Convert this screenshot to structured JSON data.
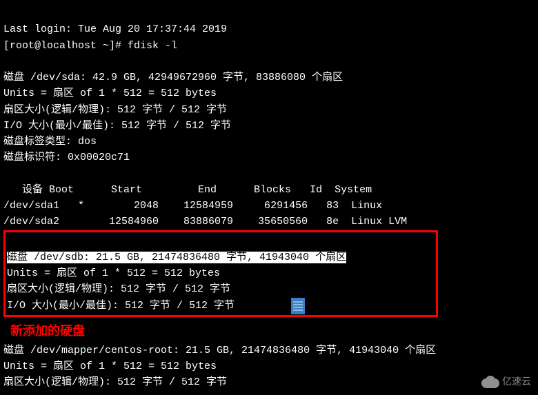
{
  "login_line": "Last login: Tue Aug 20 17:37:44 2019",
  "prompt": "[root@localhost ~]# ",
  "command": "fdisk -l",
  "blank": "",
  "disk_sda": {
    "header": "磁盘 /dev/sda: 42.9 GB, 42949672960 字节, 83886080 个扇区",
    "units": "Units = 扇区 of 1 * 512 = 512 bytes",
    "sector_size": "扇区大小(逻辑/物理): 512 字节 / 512 字节",
    "io_size": "I/O 大小(最小/最佳): 512 字节 / 512 字节",
    "label_type": "磁盘标签类型: dos",
    "identifier": "磁盘标识符: 0x00020c71"
  },
  "partition_table": {
    "header": "   设备 Boot      Start         End      Blocks   Id  System",
    "row1": "/dev/sda1   *        2048    12584959     6291456   83  Linux",
    "row2": "/dev/sda2        12584960    83886079    35650560   8e  Linux LVM"
  },
  "disk_sdb": {
    "header": "磁盘 /dev/sdb: 21.5 GB, 21474836480 字节, 41943040 个扇区",
    "units": "Units = 扇区 of 1 * 512 = 512 bytes",
    "sector_size": "扇区大小(逻辑/物理): 512 字节 / 512 字节",
    "io_size": "I/O 大小(最小/最佳): 512 字节 / 512 字节"
  },
  "annotation": "  新添加的硬盘",
  "disk_mapper": {
    "header": "磁盘 /dev/mapper/centos-root: 21.5 GB, 21474836480 字节, 41943040 个扇区",
    "units": "Units = 扇区 of 1 * 512 = 512 bytes",
    "sector_size": "扇区大小(逻辑/物理): 512 字节 / 512 字节"
  },
  "watermark": "亿速云"
}
